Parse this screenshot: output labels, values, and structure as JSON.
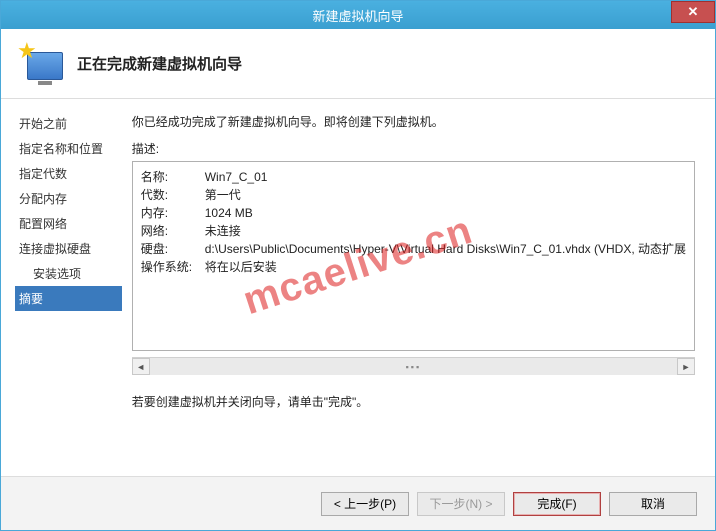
{
  "window": {
    "title": "新建虚拟机向导",
    "close_glyph": "✕"
  },
  "header": {
    "title": "正在完成新建虚拟机向导"
  },
  "sidebar": {
    "items": [
      {
        "label": "开始之前",
        "indent": false,
        "active": false
      },
      {
        "label": "指定名称和位置",
        "indent": false,
        "active": false
      },
      {
        "label": "指定代数",
        "indent": false,
        "active": false
      },
      {
        "label": "分配内存",
        "indent": false,
        "active": false
      },
      {
        "label": "配置网络",
        "indent": false,
        "active": false
      },
      {
        "label": "连接虚拟硬盘",
        "indent": false,
        "active": false
      },
      {
        "label": "安装选项",
        "indent": true,
        "active": false
      },
      {
        "label": "摘要",
        "indent": false,
        "active": true
      }
    ]
  },
  "main": {
    "intro": "你已经成功完成了新建虚拟机向导。即将创建下列虚拟机。",
    "desc_label": "描述:",
    "summary": [
      {
        "k": "名称:",
        "v": "Win7_C_01"
      },
      {
        "k": "代数:",
        "v": "第一代"
      },
      {
        "k": "内存:",
        "v": "1024 MB"
      },
      {
        "k": "网络:",
        "v": "未连接"
      },
      {
        "k": "硬盘:",
        "v": "d:\\Users\\Public\\Documents\\Hyper-V\\Virtual Hard Disks\\Win7_C_01.vhdx (VHDX, 动态扩展"
      },
      {
        "k": "操作系统:",
        "v": "将在以后安装"
      }
    ],
    "scroll_left": "◄",
    "scroll_track": "▪▪▪",
    "scroll_right": "►",
    "hint": "若要创建虚拟机并关闭向导，请单击\"完成\"。"
  },
  "footer": {
    "prev": "< 上一步(P)",
    "next": "下一步(N) >",
    "finish": "完成(F)",
    "cancel": "取消"
  },
  "watermark": "mcaelive.cn"
}
